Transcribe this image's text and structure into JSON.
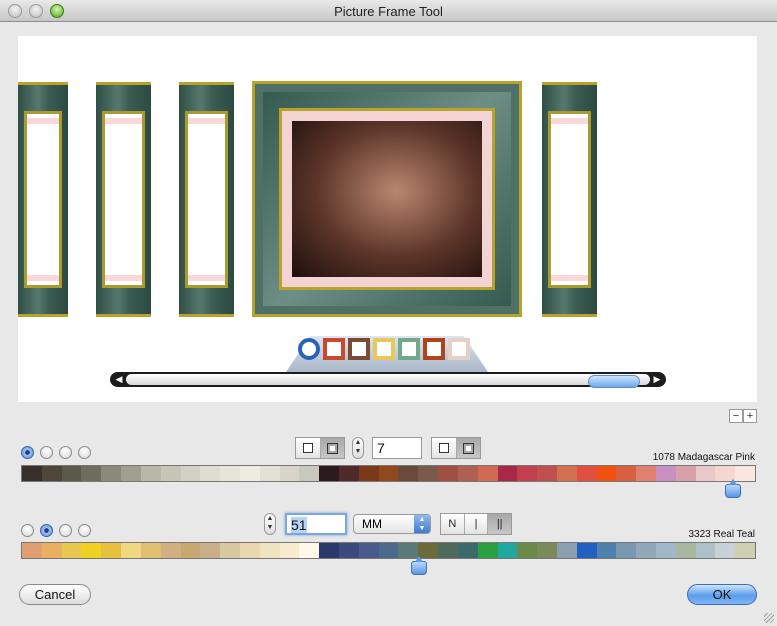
{
  "window": {
    "title": "Picture Frame Tool"
  },
  "frame_selector": {
    "swatch_colors": [
      "#2a62b8",
      "#c94a2a",
      "#7a4a34",
      "#e8c85a",
      "#6fa88a",
      "#b0431c",
      "#e6cfc4"
    ]
  },
  "zoom": {
    "out_label": "−",
    "in_label": "+"
  },
  "row1": {
    "width_value": "7",
    "color_name": "1078 Madagascar Pink",
    "colors": [
      "#3a302a",
      "#4e453b",
      "#5a5a4a",
      "#6e6e5e",
      "#8a8a7a",
      "#a0a090",
      "#b8b8a8",
      "#c8c4b8",
      "#d4d0c4",
      "#e0dcd0",
      "#e8e4d8",
      "#f0ece2",
      "#e4e0d4",
      "#d8d4c8",
      "#c8c8bc",
      "#2a1a1a",
      "#4e2a2a",
      "#7a3a1a",
      "#8e4a1c",
      "#6a4a3a",
      "#7a5a4a",
      "#a05040",
      "#b06050",
      "#d06a50",
      "#a82848",
      "#c04050",
      "#c05050",
      "#d07050",
      "#e05040",
      "#f05010",
      "#d86040",
      "#e08070",
      "#c890c0",
      "#d8a0a8",
      "#e8c8c8",
      "#f4d8d0",
      "#fae8e0"
    ]
  },
  "row2": {
    "value": "51",
    "units": "MM",
    "segment_labels": [
      "N",
      "|",
      "||"
    ],
    "color_name": "3323 Real Teal",
    "colors": [
      "#e0a070",
      "#e8b060",
      "#e8c850",
      "#f0d020",
      "#e8c040",
      "#f0d880",
      "#e0c070",
      "#d0b080",
      "#c8a870",
      "#c8b088",
      "#d8c8a0",
      "#e8d8b0",
      "#f0e4c0",
      "#f8ecd0",
      "#fff8e8",
      "#2a3a6a",
      "#3a4a7a",
      "#4a5a8a",
      "#4a6a8a",
      "#5a7a7a",
      "#6a6a3a",
      "#4e6a5a",
      "#3a6a6a",
      "#2aa040",
      "#20a8a0",
      "#6a8a4a",
      "#7a8a5a",
      "#8aa0b0",
      "#2060c0",
      "#5080b0",
      "#7a98b0",
      "#90a8b8",
      "#a0b8c8",
      "#a8b8a0",
      "#b0c0c8",
      "#c8d0d8",
      "#d0d0b0"
    ]
  },
  "radio_groups": {
    "row1_selected": 0,
    "row2_selected": 1
  },
  "buttons": {
    "cancel": "Cancel",
    "ok": "OK"
  }
}
